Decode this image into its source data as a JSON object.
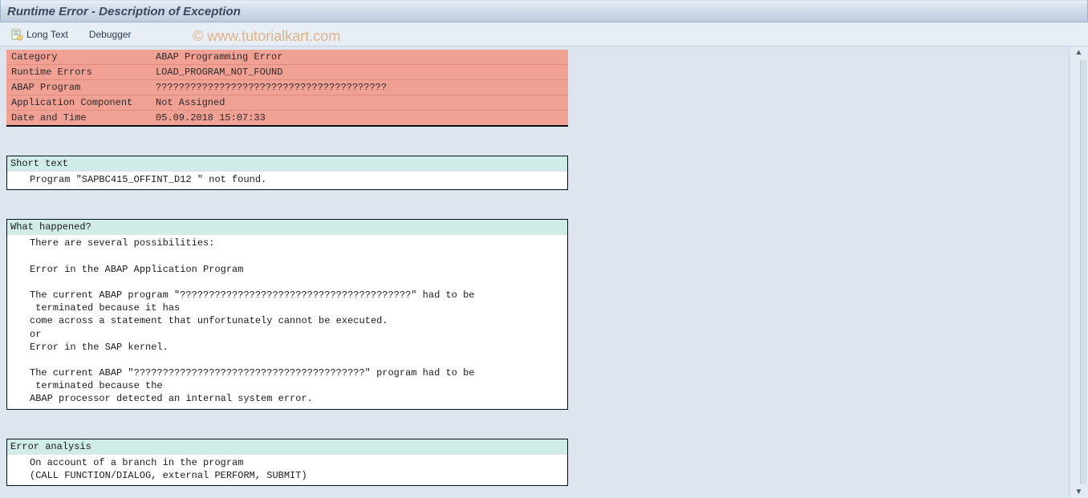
{
  "title": "Runtime Error - Description of Exception",
  "toolbar": {
    "long_text": "Long Text",
    "debugger": "Debugger"
  },
  "watermark": "© www.tutorialkart.com",
  "header_rows": [
    {
      "label": "Category",
      "value": "ABAP Programming Error"
    },
    {
      "label": "Runtime Errors",
      "value": "LOAD_PROGRAM_NOT_FOUND"
    },
    {
      "label": "ABAP Program",
      "value": "????????????????????????????????????????"
    },
    {
      "label": "Application Component",
      "value": "Not Assigned"
    },
    {
      "label": "Date and Time",
      "value": "05.09.2018 15:07:33"
    }
  ],
  "sections": [
    {
      "title": "Short text",
      "body": "Program \"SAPBC415_OFFINT_D12 \" not found."
    },
    {
      "title": "What happened?",
      "body": "There are several possibilities:\n\nError in the ABAP Application Program\n\nThe current ABAP program \"????????????????????????????????????????\" had to be\n terminated because it has\ncome across a statement that unfortunately cannot be executed.\nor\nError in the SAP kernel.\n\nThe current ABAP \"????????????????????????????????????????\" program had to be\n terminated because the\nABAP processor detected an internal system error."
    },
    {
      "title": "Error analysis",
      "body": "On account of a branch in the program\n(CALL FUNCTION/DIALOG, external PERFORM, SUBMIT)"
    }
  ]
}
